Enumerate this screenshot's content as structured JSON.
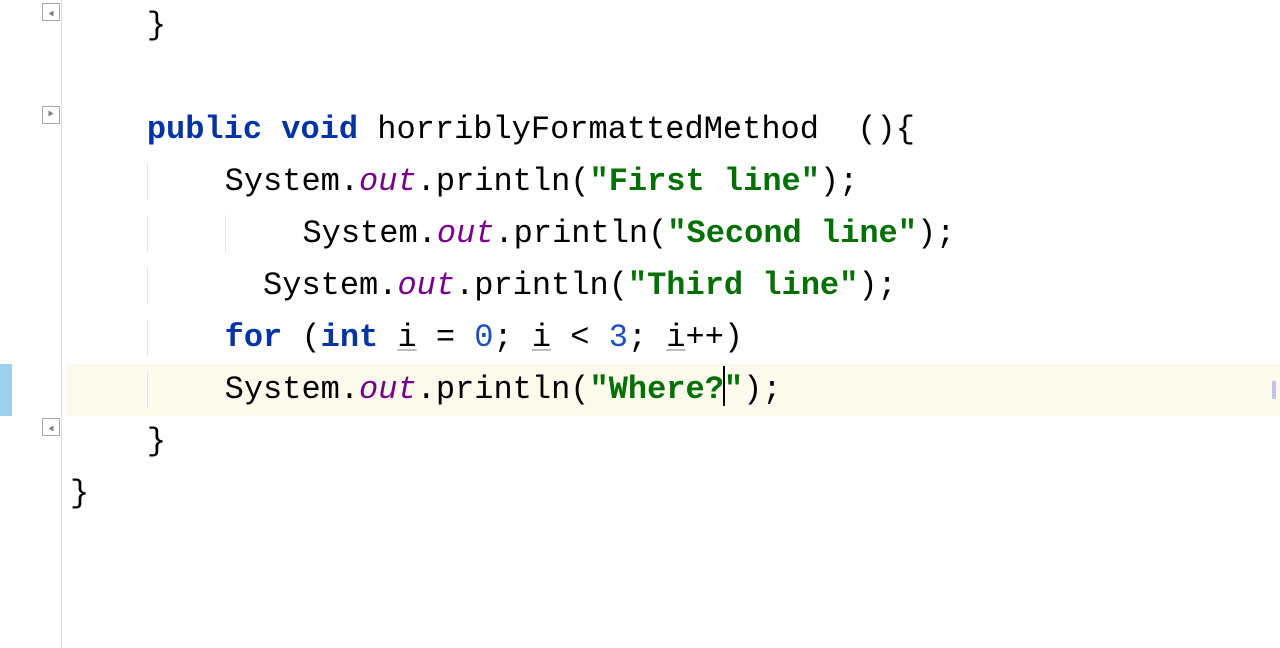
{
  "code": {
    "keywords": {
      "public": "public",
      "void": "void",
      "for": "for",
      "int": "int"
    },
    "identifiers": {
      "method_name": "horriblyFormattedMethod",
      "system": "System",
      "out": "out",
      "println": "println",
      "i": "i"
    },
    "strings": {
      "first": "\"First line\"",
      "second": "\"Second line\"",
      "third": "\"Third line\"",
      "where_open": "\"Where?",
      "where_close": "\""
    },
    "numbers": {
      "zero": "0",
      "three": "3"
    },
    "punct": {
      "open_paren_brace": "  (){",
      "dot": ".",
      "open_paren": "(",
      "close_paren_semi": ");",
      "close_brace": "}",
      "space": " ",
      "open_paren2": " (",
      "semi_space": "; ",
      "lt": " < ",
      "inc_close": "++)",
      "eq": " = "
    }
  },
  "gutter": {
    "fold_positions": [
      "start",
      "method-start",
      "method-end"
    ]
  },
  "colors": {
    "keyword": "#0434a3",
    "field": "#76008a",
    "string": "#046f04",
    "number": "#1c52bb",
    "highlight_bg": "#fcfaec",
    "gutter_highlight": "#9fd0f0"
  }
}
